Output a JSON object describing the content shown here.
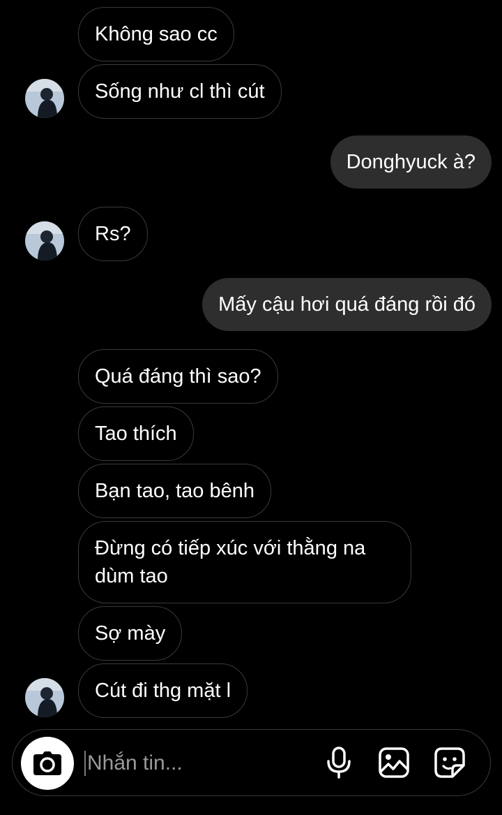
{
  "messages": [
    {
      "dir": "in",
      "text": "Không sao cc"
    },
    {
      "dir": "in",
      "text": "Sống như cl thì cút"
    },
    {
      "dir": "out",
      "text": "Donghyuck à?"
    },
    {
      "dir": "in",
      "text": "Rs?"
    },
    {
      "dir": "out",
      "text": "Mấy cậu hơi quá đáng rồi đó"
    },
    {
      "dir": "in",
      "text": "Quá đáng thì sao?"
    },
    {
      "dir": "in",
      "text": "Tao thích"
    },
    {
      "dir": "in",
      "text": "Bạn tao, tao bênh"
    },
    {
      "dir": "in",
      "text": "Đừng có tiếp xúc với thằng na dùm tao"
    },
    {
      "dir": "in",
      "text": "Sợ mày"
    },
    {
      "dir": "in",
      "text": "Cút đi thg mặt l"
    }
  ],
  "composer": {
    "placeholder": "Nhắn tin...",
    "icons": [
      "camera-icon",
      "microphone-icon",
      "gallery-icon",
      "sticker-icon"
    ]
  },
  "colors": {
    "background": "#000000",
    "outgoing_bubble": "#2e2e2e",
    "incoming_border": "#3a3a3a"
  }
}
